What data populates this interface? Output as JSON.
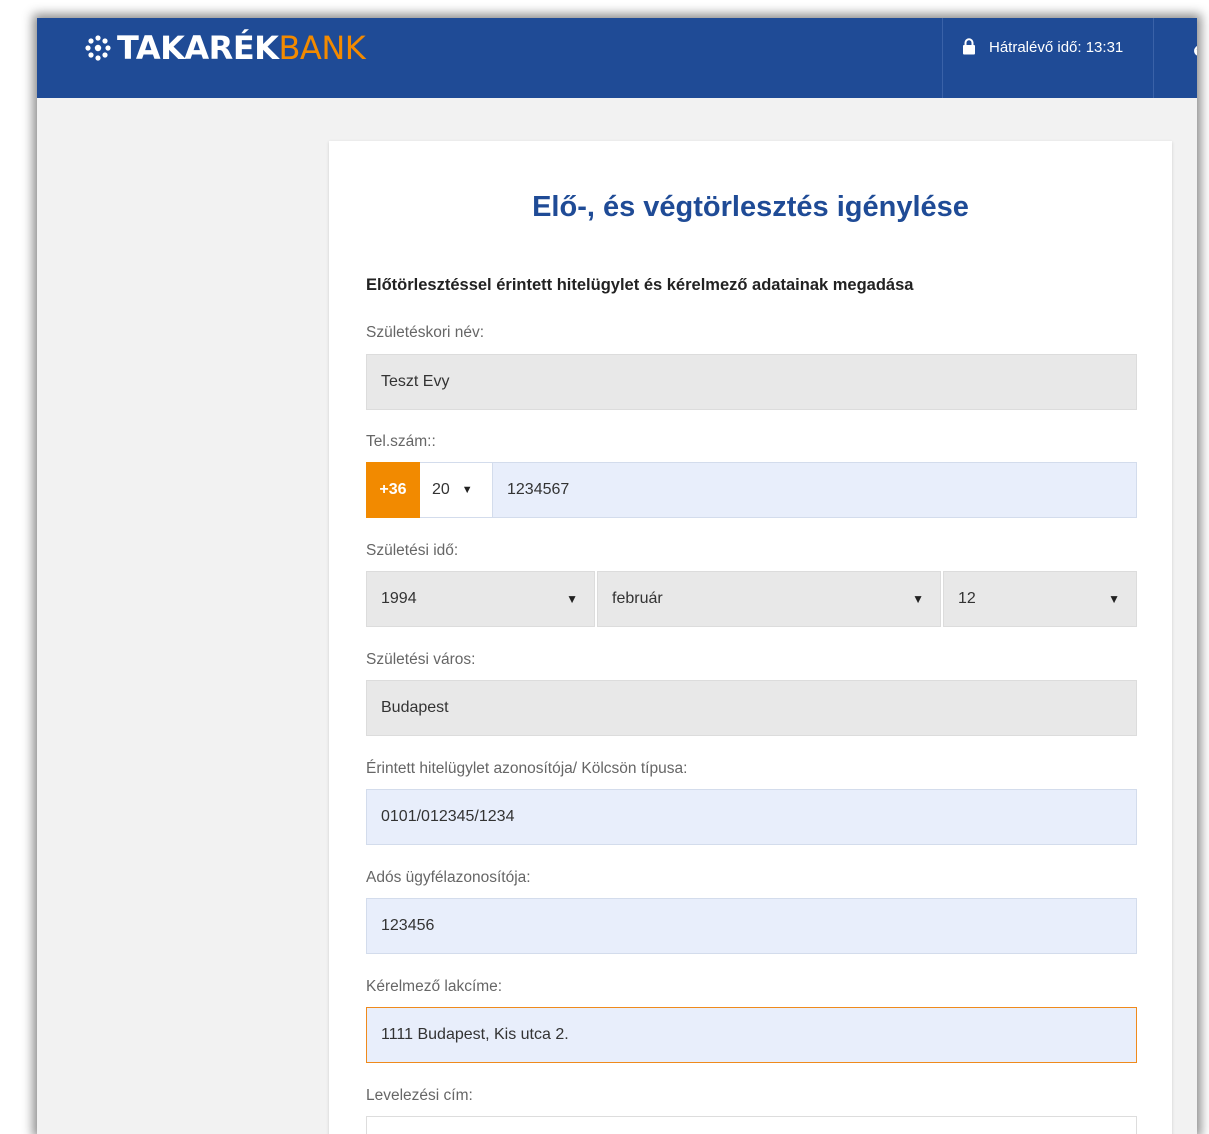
{
  "header": {
    "logo_main": "TAKARÉK",
    "logo_accent": "BANK",
    "timer_label": "Hátralévő idő: 13:31",
    "brand_blue": "#1f4b96",
    "brand_orange": "#f28a00"
  },
  "form": {
    "title": "Elő-, és végtörlesztés igénylése",
    "section_heading": "Előtörlesztéssel érintett hitelügylet és kérelmező adatainak megadása",
    "birth_name": {
      "label": "Születéskori név:",
      "value": "Teszt Evy"
    },
    "phone": {
      "label": "Tel.szám::",
      "country_code": "+36",
      "area_code": "20",
      "number": "1234567"
    },
    "birth_date": {
      "label": "Születési idő:",
      "year": "1994",
      "month": "február",
      "day": "12"
    },
    "birth_city": {
      "label": "Születési város:",
      "value": "Budapest"
    },
    "loan_id": {
      "label": "Érintett hitelügylet azonosítója/ Kölcsön típusa:",
      "value": "0101/012345/1234"
    },
    "debtor_id": {
      "label": "Adós ügyfélazonosítója:",
      "value": "123456"
    },
    "address": {
      "label": "Kérelmező lakcíme:",
      "value": "1111 Budapest, Kis utca 2."
    },
    "mailing_address": {
      "label": "Levelezési cím:",
      "value": ""
    }
  }
}
